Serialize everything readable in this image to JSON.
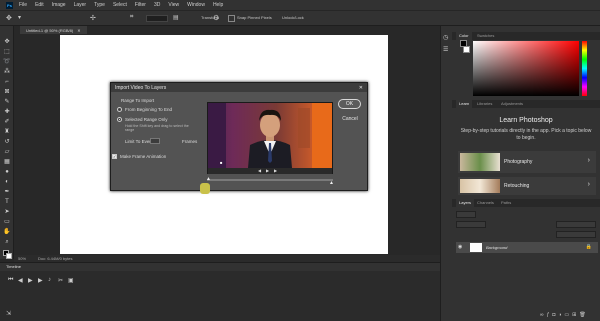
{
  "menubar": {
    "logo": "Ps",
    "items": [
      "File",
      "Edit",
      "Image",
      "Layer",
      "Type",
      "Select",
      "Filter",
      "3D",
      "View",
      "Window",
      "Help"
    ]
  },
  "optionsbar": {
    "transform_label": "Transform",
    "snap_label": "Snap Pinned Pixels",
    "unlock_label": "Unlock/Lock"
  },
  "document": {
    "tab_title": "Untitled-1 @ 50% (RGB/8)",
    "zoom": "50%",
    "doc_info": "Doc: 6.44M/0 bytes"
  },
  "timeline": {
    "title": "Timeline"
  },
  "color_panel": {
    "tabs": [
      "Color",
      "Swatches"
    ],
    "accent": "#ff0000"
  },
  "learn_panel": {
    "tabs": [
      "Learn",
      "Libraries",
      "Adjustments"
    ],
    "title": "Learn Photoshop",
    "description": "Step-by-step tutorials directly in the app. Pick a topic below to begin.",
    "cards": [
      {
        "label": "Photography"
      },
      {
        "label": "Retouching"
      }
    ]
  },
  "layers_panel": {
    "tabs": [
      "Layers",
      "Channels",
      "Paths"
    ],
    "layer_name": "Background"
  },
  "dialog": {
    "title": "Import Video To Layers",
    "close": "✕",
    "range_heading": "Range To Import",
    "option_all": "From Beginning To End",
    "option_selected": "Selected Range Only",
    "hint": "Hold the Shift key and drag to select the range",
    "limit_label": "Limit To Every",
    "frames_label": "Frames",
    "make_animation": "Make Frame Animation",
    "ok": "OK",
    "cancel": "Cancel"
  }
}
